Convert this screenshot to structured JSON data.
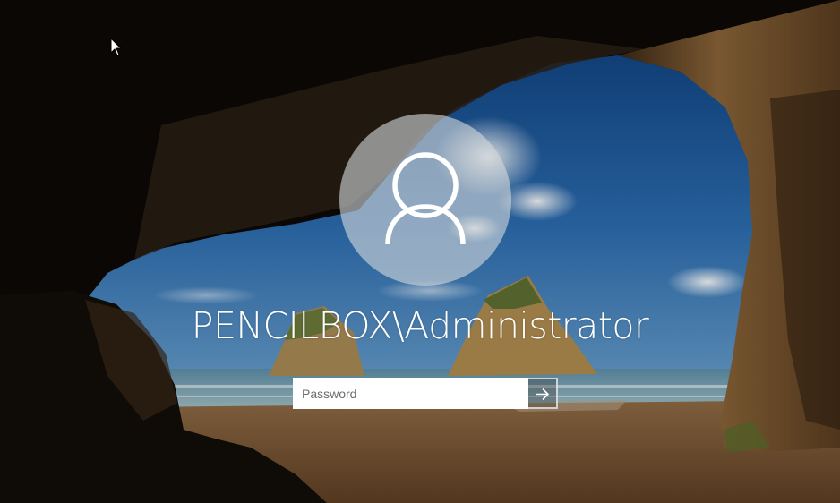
{
  "login": {
    "username": "PENCILBOX\\Administrator",
    "password_placeholder": "Password",
    "password_value": ""
  },
  "icons": {
    "avatar": "user-silhouette-icon",
    "submit": "arrow-right-icon",
    "cursor": "mouse-pointer-icon"
  },
  "colors": {
    "text": "#ffffff",
    "avatar_background": "#c8ccd0",
    "input_background": "#ffffff"
  }
}
